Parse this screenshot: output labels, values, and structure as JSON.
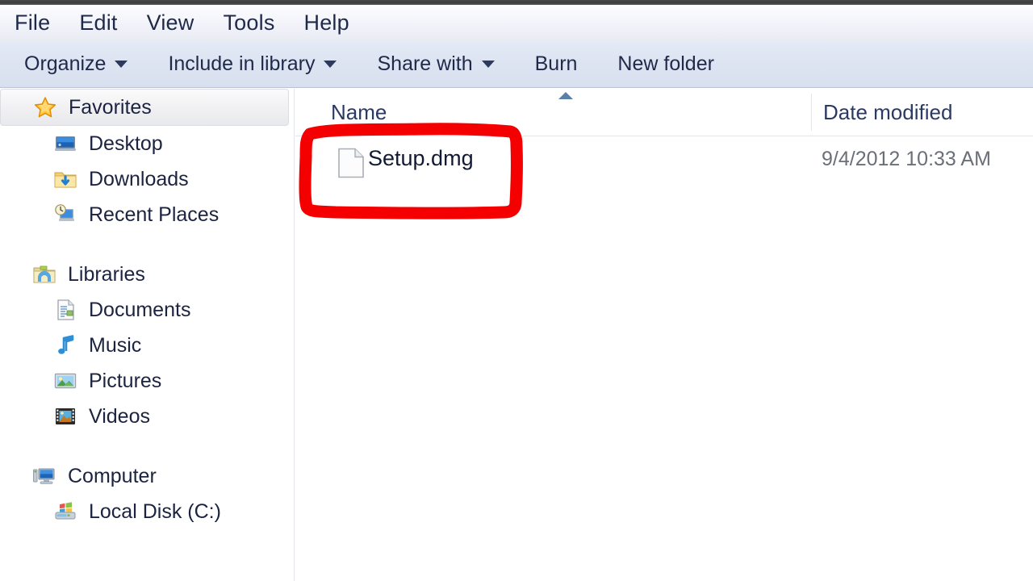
{
  "window": {
    "title": "Windows Explorer"
  },
  "menubar": {
    "items": [
      {
        "label": "File",
        "name": "menu-file"
      },
      {
        "label": "Edit",
        "name": "menu-edit"
      },
      {
        "label": "View",
        "name": "menu-view"
      },
      {
        "label": "Tools",
        "name": "menu-tools"
      },
      {
        "label": "Help",
        "name": "menu-help"
      }
    ]
  },
  "toolbar": {
    "organize_label": "Organize",
    "include_label": "Include in library",
    "share_label": "Share with",
    "burn_label": "Burn",
    "new_folder_label": "New folder"
  },
  "sidebar": {
    "favorites": {
      "label": "Favorites",
      "icon": "star-icon",
      "selected": true,
      "children": [
        {
          "label": "Desktop",
          "icon": "desktop-icon"
        },
        {
          "label": "Downloads",
          "icon": "downloads-folder-icon"
        },
        {
          "label": "Recent Places",
          "icon": "recent-places-icon"
        }
      ]
    },
    "libraries": {
      "label": "Libraries",
      "icon": "libraries-icon",
      "children": [
        {
          "label": "Documents",
          "icon": "documents-icon"
        },
        {
          "label": "Music",
          "icon": "music-note-icon"
        },
        {
          "label": "Pictures",
          "icon": "pictures-icon"
        },
        {
          "label": "Videos",
          "icon": "videos-filmstrip-icon"
        }
      ]
    },
    "computer": {
      "label": "Computer",
      "icon": "computer-icon",
      "children": [
        {
          "label": "Local Disk (C:)",
          "icon": "hard-drive-icon"
        }
      ]
    }
  },
  "file_list": {
    "columns": {
      "name": "Name",
      "date_modified": "Date modified"
    },
    "sort": {
      "column": "Name",
      "direction": "ascending"
    },
    "rows": [
      {
        "name": "Setup.dmg",
        "date_modified": "9/4/2012 10:33 AM",
        "icon": "generic-file-icon"
      }
    ]
  },
  "annotation": {
    "type": "hand-drawn-rectangle",
    "color": "#f40000",
    "target": "Setup.dmg"
  }
}
